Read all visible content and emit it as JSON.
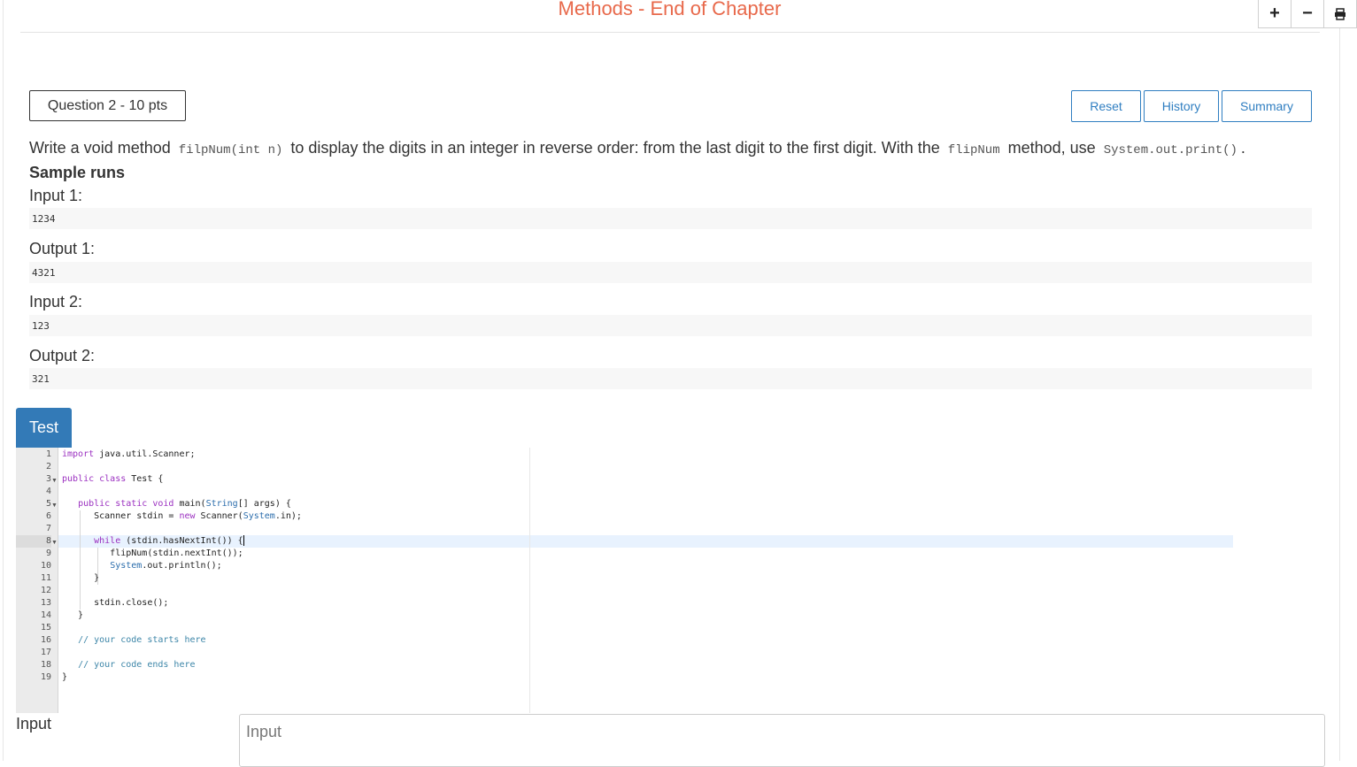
{
  "header": {
    "title": "Methods - End of Chapter",
    "zoom_in_label": "+",
    "zoom_out_label": "−"
  },
  "question": {
    "tag": "Question 2 - 10 pts",
    "buttons": {
      "reset": "Reset",
      "history": "History",
      "summary": "Summary"
    },
    "description": {
      "part1": "Write a void method",
      "code1": "filpNum(int n)",
      "part2": "to display the digits in an integer in reverse order: from the last digit to the first digit. With the",
      "code2": "flipNum",
      "part3": "method, use",
      "code3": "System.out.print()",
      "part4": "."
    },
    "sample_heading": "Sample runs",
    "samples": [
      {
        "label": "Input 1:",
        "value": "1234"
      },
      {
        "label": "Output 1:",
        "value": "4321"
      },
      {
        "label": "Input 2:",
        "value": "123"
      },
      {
        "label": "Output 2:",
        "value": "321"
      }
    ]
  },
  "editor": {
    "tab_label": "Test",
    "line_numbers": [
      "1",
      "2",
      "3",
      "4",
      "5",
      "6",
      "7",
      "8",
      "9",
      "10",
      "11",
      "12",
      "13",
      "14",
      "15",
      "16",
      "17",
      "18",
      "19"
    ],
    "active_line": 8
  },
  "input_section": {
    "label": "Input",
    "placeholder": "Input"
  }
}
